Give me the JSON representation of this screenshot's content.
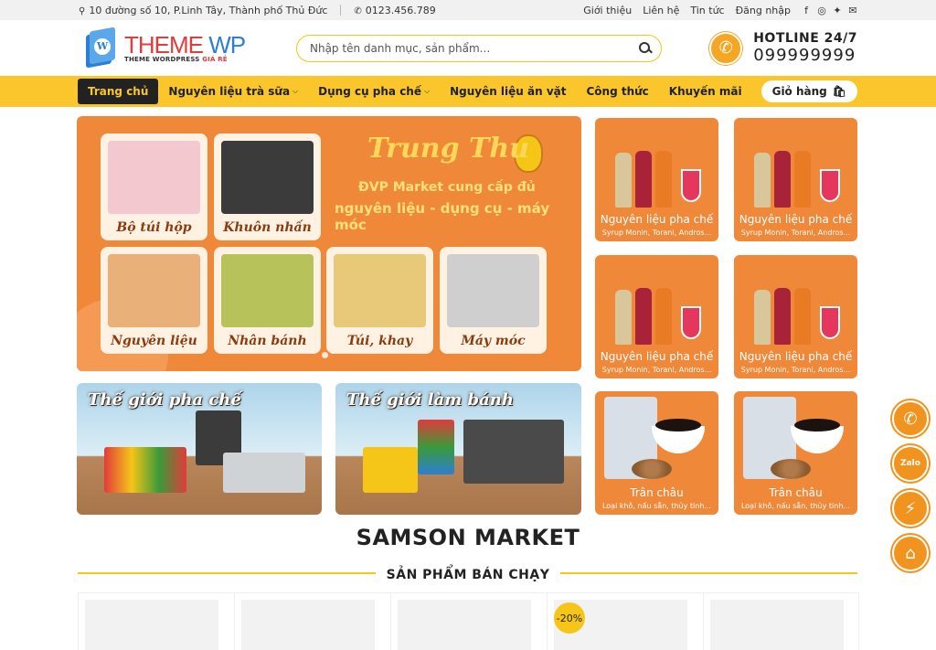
{
  "topbar": {
    "address": "10 đường số 10, P.Linh Tây, Thành phố Thủ Đức",
    "phone": "0123.456.789",
    "links": [
      "Giới thiệu",
      "Liên hệ",
      "Tin tức",
      "Đăng nhập"
    ],
    "social_icons": [
      "facebook-icon",
      "instagram-icon",
      "twitter-icon",
      "mail-icon"
    ]
  },
  "logo": {
    "word1": "THEME",
    "word2": "WP",
    "tagline_main": "THEME WORDPRESS",
    "tagline_accent": "GIÁ RẺ",
    "mark_letter": "W"
  },
  "search": {
    "placeholder": "Nhập tên danh mục, sản phẩm..."
  },
  "hotline": {
    "label": "HOTLINE 24/7",
    "number": "099999999"
  },
  "nav": {
    "items": [
      {
        "label": "Trang chủ",
        "active": true,
        "dropdown": false
      },
      {
        "label": "Nguyên liệu trà sữa",
        "active": false,
        "dropdown": true
      },
      {
        "label": "Dụng cụ pha chế",
        "active": false,
        "dropdown": true
      },
      {
        "label": "Nguyên liệu ăn vặt",
        "active": false,
        "dropdown": false
      },
      {
        "label": "Công thức",
        "active": false,
        "dropdown": false
      },
      {
        "label": "Khuyến mãi",
        "active": false,
        "dropdown": false
      }
    ],
    "cart_label": "Giỏ hàng"
  },
  "hero": {
    "title": "Trung Thu",
    "line1": "ĐVP Market cung cấp đủ",
    "line2": "nguyên liệu - dụng cụ - máy móc",
    "tiles": [
      "Bộ túi hộp",
      "Khuôn nhấn",
      "Nguyên liệu",
      "Nhân bánh",
      "Túi, khay",
      "Máy móc"
    ]
  },
  "banners": [
    "Thế giới pha chế",
    "Thế giới làm bánh"
  ],
  "categories": [
    {
      "name": "Nguyên liệu pha chế",
      "desc": "Syrup Monin, Torani, Andros..."
    },
    {
      "name": "Nguyên liệu pha chế",
      "desc": "Syrup Monin, Torani, Andros..."
    },
    {
      "name": "Nguyên liệu pha chế",
      "desc": "Syrup Monin, Torani, Andros..."
    },
    {
      "name": "Nguyên liệu pha chế",
      "desc": "Syrup Monin, Torani, Andros..."
    },
    {
      "name": "Trân châu",
      "desc": "Loại khô, nấu sẵn, thủy tinh..."
    },
    {
      "name": "Trân châu",
      "desc": "Loại khô, nấu sẵn, thủy tinh..."
    }
  ],
  "section": {
    "brand": "SAMSON MARKET",
    "best_sellers": "SẢN PHẨM BÁN CHẠY"
  },
  "products": [
    {
      "sale": ""
    },
    {
      "sale": ""
    },
    {
      "sale": ""
    },
    {
      "sale": "-20%"
    },
    {
      "sale": ""
    }
  ],
  "floating_buttons": [
    "phone-icon",
    "zalo-icon",
    "messenger-icon",
    "map-icon"
  ],
  "floating_zalo_text": "Zalo",
  "colors": {
    "accent_yellow": "#fbc62b",
    "accent_orange": "#f0883a",
    "dark": "#222222"
  }
}
